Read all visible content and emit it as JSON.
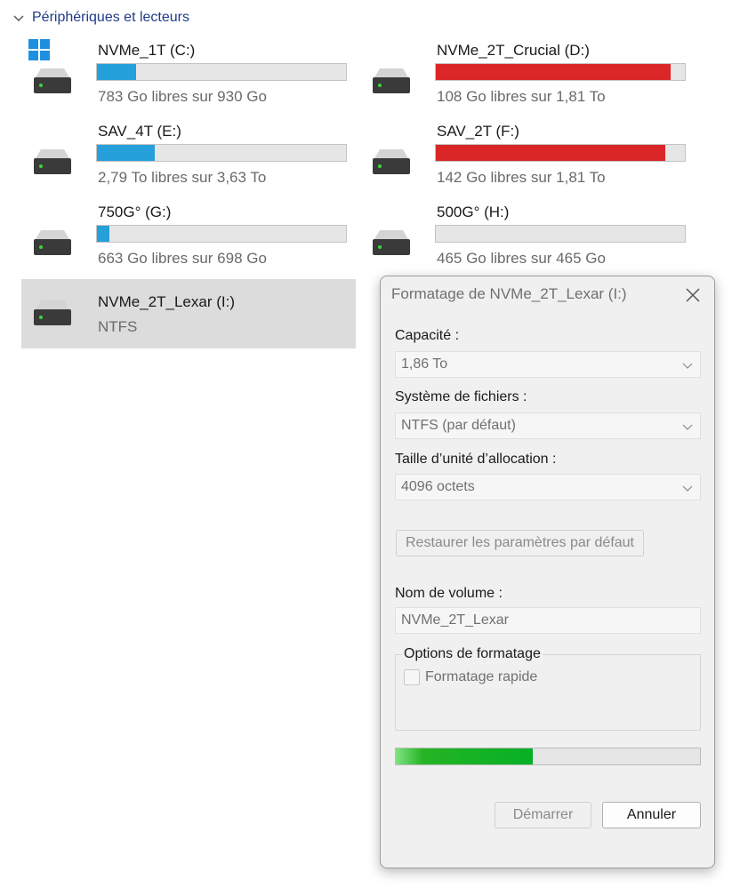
{
  "section": {
    "title": "Périphériques et lecteurs",
    "icon": "chevron-down-icon"
  },
  "drives": [
    {
      "name": "NVMe_1T (C:)",
      "free_text": "783 Go libres sur 930 Go",
      "used_fraction": 0.158,
      "bar_color": "#26a0da",
      "system_logo": "windows-logo-icon"
    },
    {
      "name": "NVMe_2T_Crucial (D:)",
      "free_text": "108 Go libres sur 1,81 To",
      "used_fraction": 0.942,
      "bar_color": "#da2626"
    },
    {
      "name": "SAV_4T (E:)",
      "free_text": "2,79 To libres sur 3,63 To",
      "used_fraction": 0.231,
      "bar_color": "#26a0da"
    },
    {
      "name": "SAV_2T (F:)",
      "free_text": "142 Go libres sur 1,81 To",
      "used_fraction": 0.923,
      "bar_color": "#da2626"
    },
    {
      "name": "750G° (G:)",
      "free_text": "663 Go libres sur 698 Go",
      "used_fraction": 0.05,
      "bar_color": "#26a0da"
    },
    {
      "name": "500G° (H:)",
      "free_text": "465 Go libres sur 465 Go",
      "used_fraction": 0.0,
      "bar_color": "#26a0da"
    },
    {
      "name": "NVMe_2T_Lexar (I:)",
      "filesystem": "NTFS",
      "selected": true
    }
  ],
  "dialog": {
    "title": "Formatage de NVMe_2T_Lexar (I:)",
    "capacity_label": "Capacité :",
    "capacity_value": "1,86 To",
    "filesystem_label": "Système de fichiers :",
    "filesystem_value": "NTFS (par défaut)",
    "allocation_label": "Taille d’unité d’allocation :",
    "allocation_value": "4096 octets",
    "restore_button": "Restaurer les paramètres par défaut",
    "volume_label": "Nom de volume :",
    "volume_value": "NVMe_2T_Lexar",
    "options_legend": "Options de formatage",
    "quick_format_label": "Formatage rapide",
    "quick_format_checked": false,
    "progress_fraction": 0.45,
    "progress_color": "#06b025",
    "start_button": "Démarrer",
    "cancel_button": "Annuler"
  }
}
